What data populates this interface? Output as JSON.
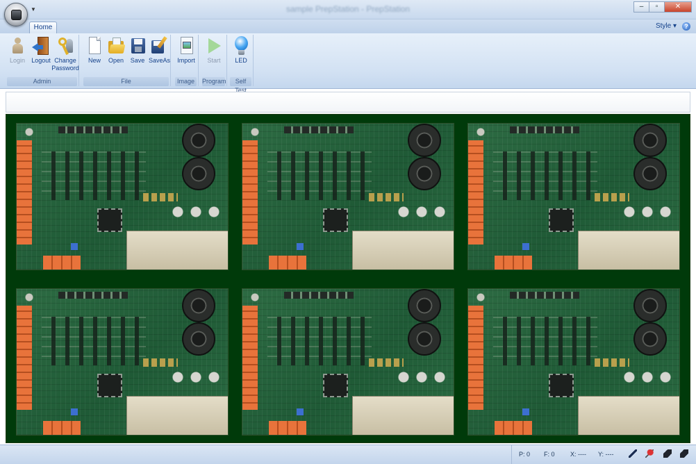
{
  "window": {
    "title": "sample PrepStation - PrepStation",
    "controls": {
      "minimize": "–",
      "maximize": "▫",
      "close": "✕"
    }
  },
  "tabs": {
    "home": "Home",
    "style": "Style",
    "style_arrow": "▾",
    "help": "?"
  },
  "ribbon": {
    "admin": {
      "label": "Admin",
      "login": "Login",
      "logout": "Logout",
      "change_password": "Change Password"
    },
    "file": {
      "label": "File",
      "new": "New",
      "open": "Open",
      "save": "Save",
      "saveas": "SaveAs"
    },
    "image": {
      "label": "Image",
      "import": "Import"
    },
    "program": {
      "label": "Program",
      "start": "Start"
    },
    "selftest": {
      "label": "Self Test",
      "led": "LED"
    }
  },
  "image_area": {
    "board_count": 6,
    "background_color": "#003a0a",
    "pcb_color": "#2d6b43"
  },
  "statusbar": {
    "p_label": "P: 0",
    "f_label": "F: 0",
    "x_label": "X: ----",
    "y_label": "Y: ----",
    "icons": [
      "pen-icon",
      "pin-icon",
      "eraser-icon",
      "eraser-icon"
    ]
  }
}
